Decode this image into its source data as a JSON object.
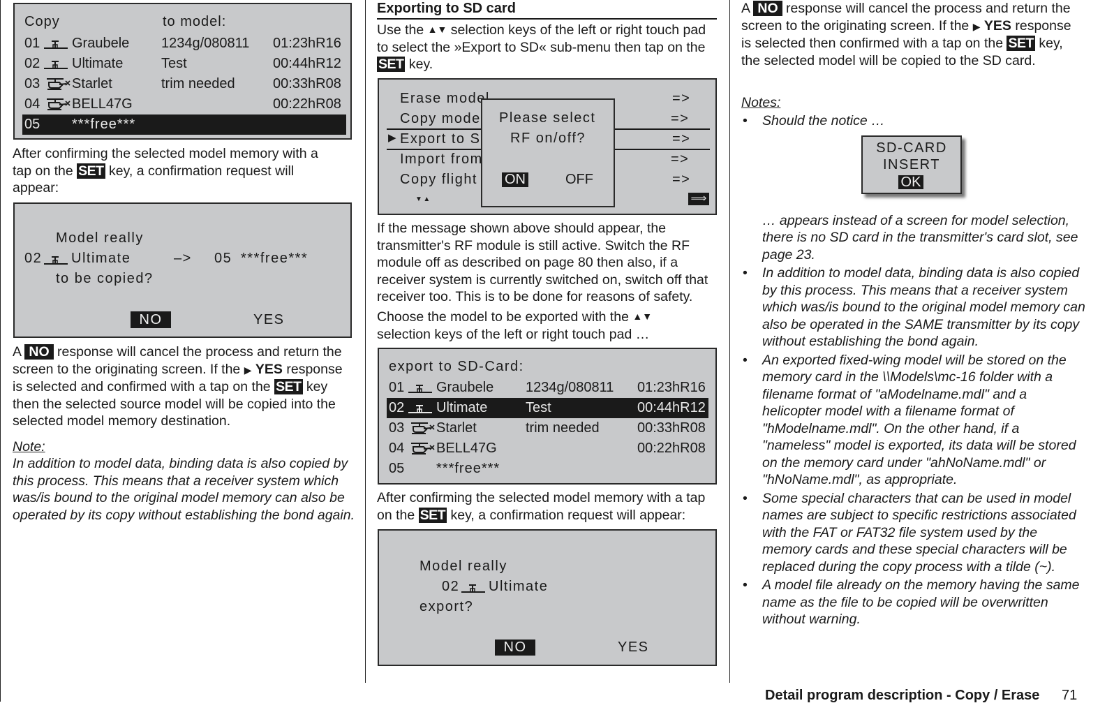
{
  "left_column": {
    "copy_screen": {
      "header_left": "Copy",
      "header_right": "to model:",
      "rows": [
        {
          "num": "01",
          "type": "plane-icon",
          "name": "Graubele",
          "note": "1234g/080811",
          "time": "01:23hR16",
          "selected": false
        },
        {
          "num": "02",
          "type": "plane-icon",
          "name": "Ultimate",
          "note": "Test",
          "time": "00:44hR12",
          "selected": false
        },
        {
          "num": "03",
          "type": "helicopter-icon",
          "name": "Starlet",
          "note": "trim needed",
          "time": "00:33hR08",
          "selected": false
        },
        {
          "num": "04",
          "type": "helicopter-icon",
          "name": "BELL47G",
          "note": "",
          "time": "00:22hR08",
          "selected": false
        },
        {
          "num": "05",
          "type": "",
          "name": "***free***",
          "note": "",
          "time": "",
          "selected": true
        }
      ]
    },
    "para1": {
      "before": "After confirming the selected model memory with a tap on the",
      "key": "SET",
      "after": "key, a confirmation request will appear:"
    },
    "confirm_screen": {
      "line1": "Model really",
      "source_num": "02",
      "source_name": "Ultimate",
      "arrow": "–>",
      "dest_num": "05",
      "dest_name": "***free***",
      "line3": "to be copied?",
      "no_label": "NO",
      "yes_label": "YES"
    },
    "para2": {
      "a": "A",
      "no_key": "NO",
      "t1": "response will cancel the process and return the screen to the originating screen. If the",
      "yes_arrow": "▶",
      "yes": "YES",
      "t2": "response is selected and confirmed with a tap on the",
      "set_key": "SET",
      "t3": "key then the selected source model will be copied into the selected model memory destination."
    },
    "note_label": "Note:",
    "note_text": "In addition to model data, binding data is also copied by this process. This means that a receiver system which was/is bound to the original model memory can also be operated by its copy without establishing the bond again."
  },
  "middle_column": {
    "heading": "Exporting to SD card",
    "para1": {
      "t1": "Use the",
      "arrows": "▲▼",
      "t2": "selection keys of the left or right touch pad to select the »Export to SD« sub-menu then tap on the",
      "key": "SET",
      "t3": "key."
    },
    "menu_screen": {
      "items": [
        {
          "label": "Erase model",
          "arrow": "=>"
        },
        {
          "label": "Copy model",
          "arrow": "=>"
        },
        {
          "label": "Export to SD",
          "arrow": "=>",
          "selected": true
        },
        {
          "label": "Import from SD",
          "arrow": "=>"
        },
        {
          "label": "Copy flight phase",
          "arrow": "=>"
        }
      ],
      "scroll_arrows": "▼▲",
      "next_icon": "right-arrow-icon",
      "popup": {
        "line1": "Please select",
        "line2": "RF on/off?",
        "on_label": "ON",
        "off_label": "OFF"
      }
    },
    "para2": "If the message shown above should appear, the transmitter's RF module is still active. Switch the RF module off as described on page 80 then also, if a receiver system is currently switched on, switch off that receiver too. This is to be done for reasons of safety.",
    "para3": {
      "t1": "Choose the model to be exported with the",
      "arrows": "▲▼",
      "t2": "selection keys of the left or right touch pad …"
    },
    "export_screen": {
      "header": "export to SD-Card:",
      "rows": [
        {
          "num": "01",
          "type": "plane-icon",
          "name": "Graubele",
          "note": "1234g/080811",
          "time": "01:23hR16",
          "selected": false
        },
        {
          "num": "02",
          "type": "plane-icon",
          "name": "Ultimate",
          "note": "Test",
          "time": "00:44hR12",
          "selected": true
        },
        {
          "num": "03",
          "type": "helicopter-icon",
          "name": "Starlet",
          "note": "trim needed",
          "time": "00:33hR08",
          "selected": false
        },
        {
          "num": "04",
          "type": "helicopter-icon",
          "name": "BELL47G",
          "note": "",
          "time": "00:22hR08",
          "selected": false
        },
        {
          "num": "05",
          "type": "",
          "name": "***free***",
          "note": "",
          "time": "",
          "selected": false
        }
      ]
    },
    "para4": {
      "before": "After confirming the selected model memory with a tap on the",
      "key": "SET",
      "after": "key, a confirmation request will appear:"
    },
    "export_confirm": {
      "line1": "Model really",
      "num": "02",
      "name": "Ultimate",
      "line3": "export?",
      "no_label": "NO",
      "yes_label": "YES"
    }
  },
  "right_column": {
    "para1": {
      "a": "A",
      "no_key": "NO",
      "t1": "response will cancel the process and return the screen to the originating screen. If the",
      "yes_arrow": "▶",
      "yes": "YES",
      "t2": "response is selected then confirmed with a tap on the",
      "set_key": "SET",
      "t3": "key, the selected model will be copied to the SD card."
    },
    "notes_label": "Notes:",
    "note1_lead": "Should the notice …",
    "sd_screen": {
      "line1": "SD-CARD",
      "line2": "INSERT",
      "ok_label": "OK"
    },
    "note1_rest": "… appears instead of a screen for model selection, there is no SD card in the transmitter's card slot, see page 23.",
    "notes": [
      "In addition to model data, binding data is also copied by this process. This means that a receiver system which was/is bound to the original model memory can also be operated in the SAME transmitter by its copy without establishing the bond again.",
      "An exported fixed-wing model will be stored on the memory card in the \\\\Models\\mc-16 folder with a filename format of \"aModelname.mdl\" and a helicopter model with a filename format of \"hModelname.mdl\". On the other hand, if a \"nameless\" model is exported, its data will be stored on the memory card under \"ahNoName.mdl\" or \"hNoName.mdl\", as appropriate.",
      "Some special characters that can be used in model names are subject to specific restrictions associated with the FAT or FAT32 file system used by the memory cards and these special characters will be replaced during the copy process with a tilde (~).",
      "A model file already on the memory having the same name as the file to be copied will be overwritten without warning."
    ],
    "bullet": "•"
  },
  "footer": {
    "title": "Detail program description - Copy / Erase",
    "page_number": "71"
  }
}
